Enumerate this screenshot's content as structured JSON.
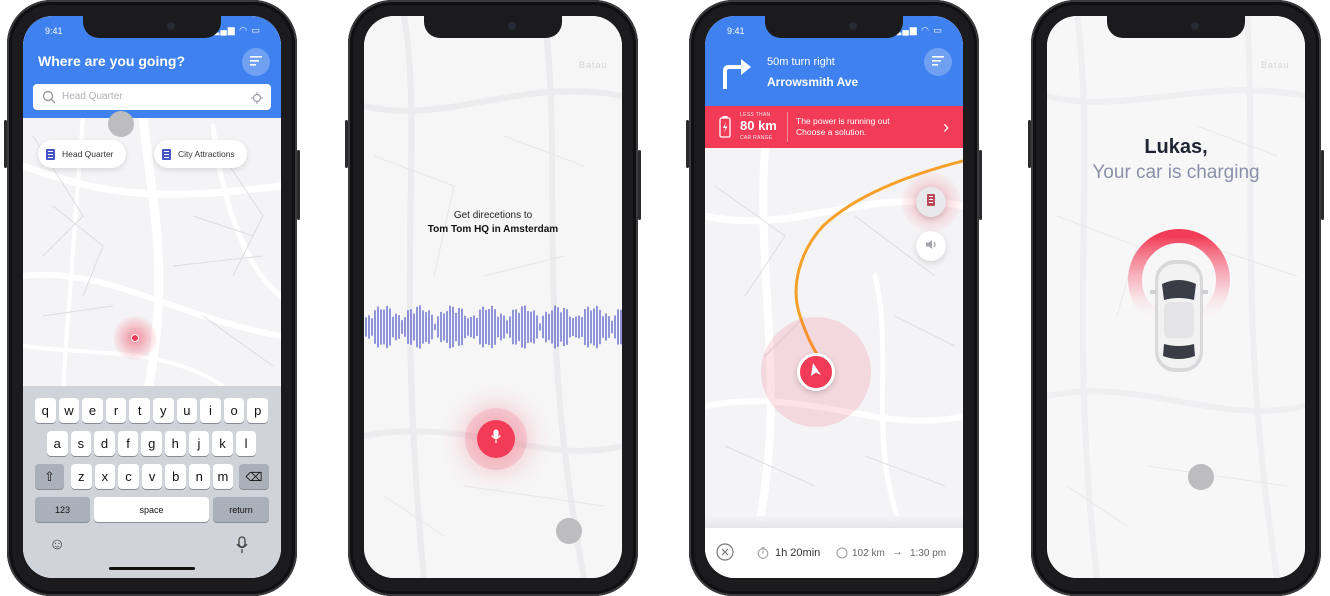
{
  "phone1": {
    "status_time": "9:41",
    "title": "Where are you going?",
    "search_placeholder": "Head Quarter",
    "chips": [
      "Head Quarter",
      "City Attractions"
    ],
    "keyboard_rows": [
      [
        "q",
        "w",
        "e",
        "r",
        "t",
        "y",
        "u",
        "i",
        "o",
        "p"
      ],
      [
        "a",
        "s",
        "d",
        "f",
        "g",
        "h",
        "j",
        "k",
        "l"
      ],
      [
        "z",
        "x",
        "c",
        "v",
        "b",
        "n",
        "m"
      ]
    ],
    "key_123": "123",
    "key_space": "space",
    "key_return": "return"
  },
  "phone2": {
    "line1": "Get direcetions to",
    "line2": "Tom Tom HQ in Amsterdam"
  },
  "phone3": {
    "status_time": "9:41",
    "instruction": "50m turn right",
    "street": "Arrowsmith Ave",
    "alert_less_than": "LESS THAN",
    "alert_range": "80 km",
    "alert_car_range": "CAR RANGE",
    "alert_line1": "The power is running out",
    "alert_line2": "Choose a solution.",
    "duration": "1h 20min",
    "distance": "102 km",
    "arrival": "1:30 pm"
  },
  "phone4": {
    "name": "Lukas,",
    "subtitle": "Your car is charging"
  },
  "colors": {
    "primary": "#3f81ee",
    "accent": "#f23b56"
  }
}
